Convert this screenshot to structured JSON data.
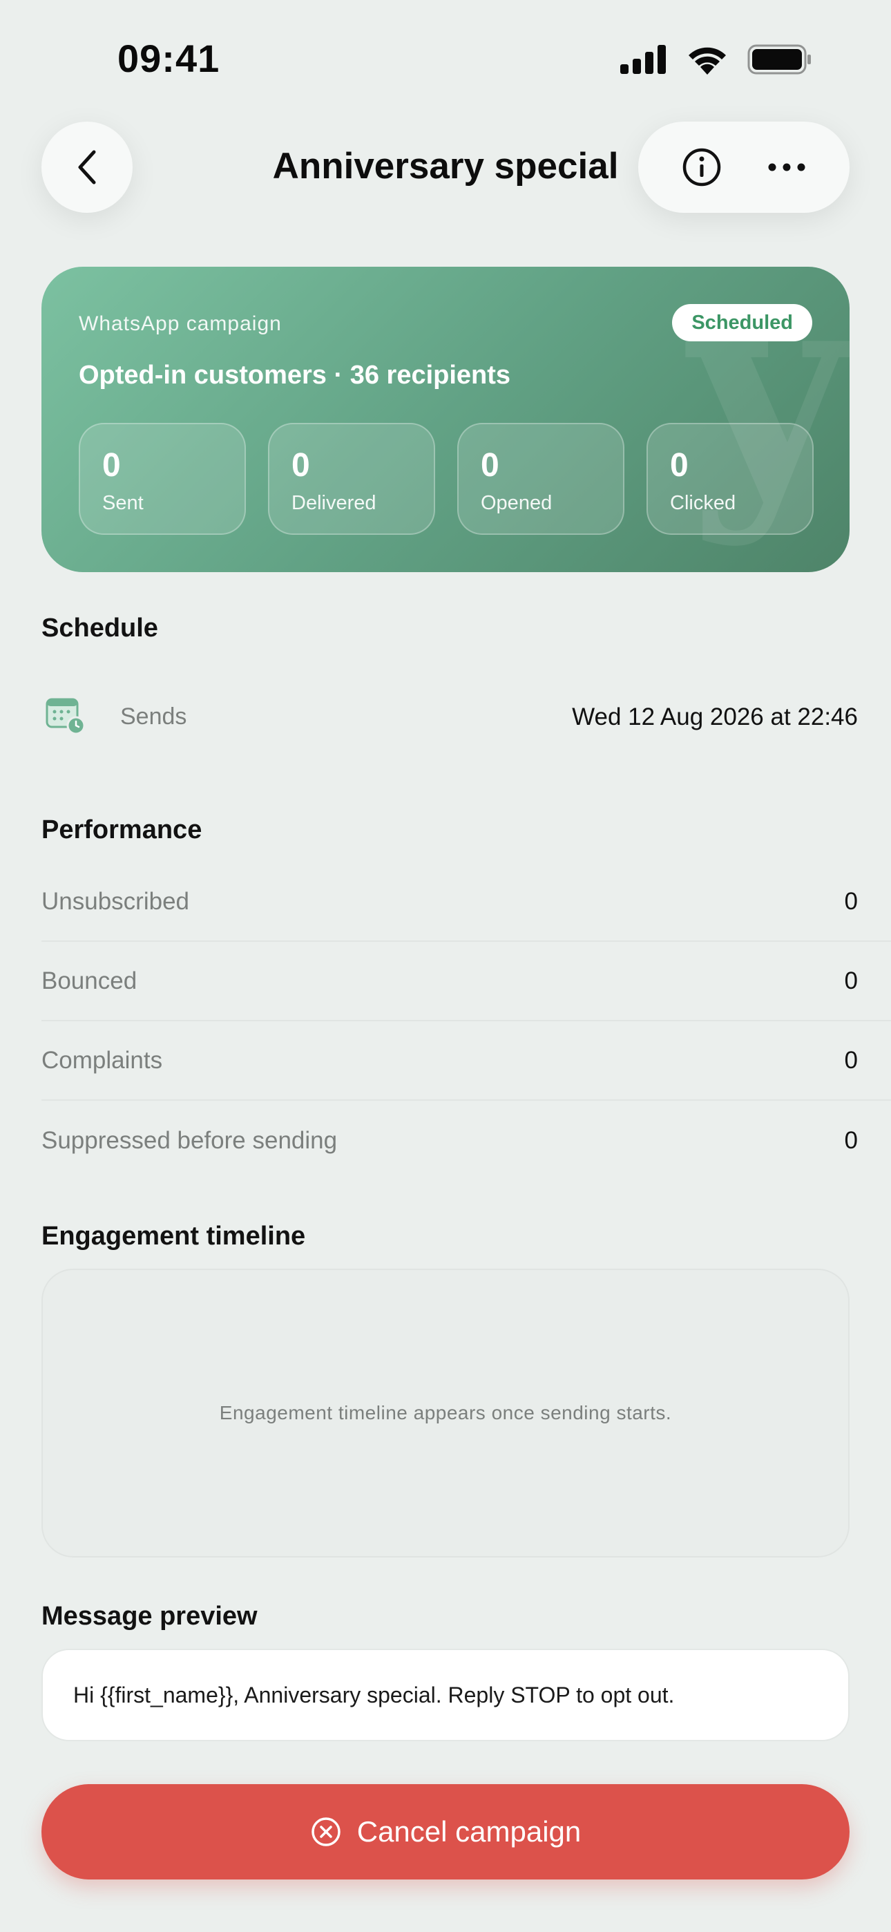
{
  "status_bar": {
    "time": "09:41"
  },
  "nav": {
    "title": "Anniversary special"
  },
  "hero": {
    "watermark": "y",
    "label": "WhatsApp campaign",
    "badge": "Scheduled",
    "audience": "Opted-in customers · 36 recipients",
    "stats": [
      {
        "value": "0",
        "label": "Sent"
      },
      {
        "value": "0",
        "label": "Delivered"
      },
      {
        "value": "0",
        "label": "Opened"
      },
      {
        "value": "0",
        "label": "Clicked"
      }
    ]
  },
  "schedule": {
    "title": "Schedule",
    "label": "Sends",
    "value": "Wed 12 Aug 2026 at 22:46"
  },
  "performance": {
    "title": "Performance",
    "rows": [
      {
        "label": "Unsubscribed",
        "value": "0"
      },
      {
        "label": "Bounced",
        "value": "0"
      },
      {
        "label": "Complaints",
        "value": "0"
      },
      {
        "label": "Suppressed before sending",
        "value": "0"
      }
    ]
  },
  "timeline": {
    "title": "Engagement timeline",
    "empty": "Engagement timeline appears once sending starts."
  },
  "preview": {
    "title": "Message preview",
    "text": "Hi {{first_name}}, Anniversary special. Reply STOP to opt out."
  },
  "cancel": {
    "label": "Cancel campaign"
  },
  "colors": {
    "accent_green": "#3c9665",
    "danger": "#dc524b",
    "background": "#ebefed"
  }
}
